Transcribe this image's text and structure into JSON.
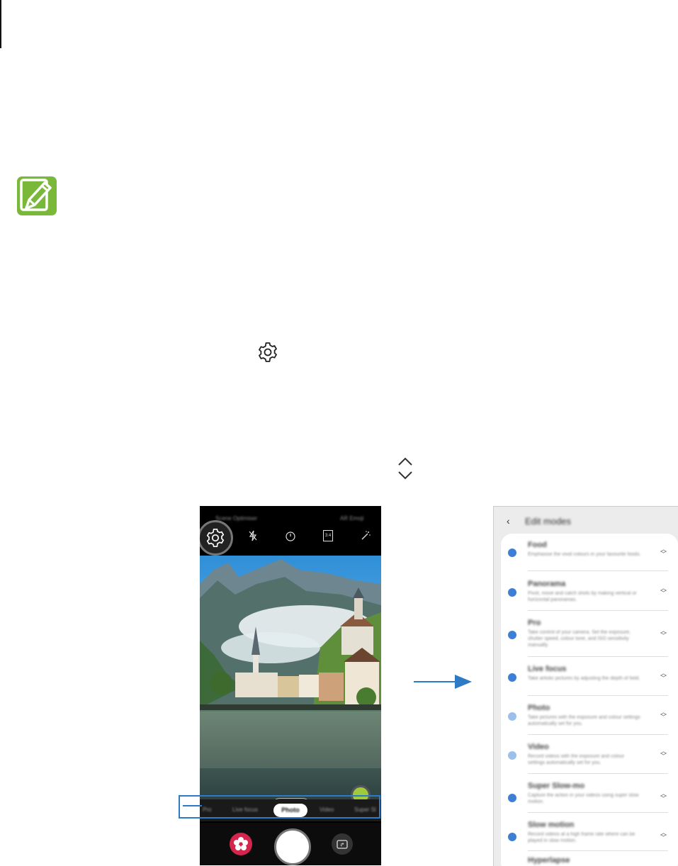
{
  "page": {
    "marker_color": "#111111",
    "note_icon": "note-pencil-icon",
    "note_icon_color": "#7ab83a",
    "inline_icons": [
      "gear-icon",
      "up-down-chevron-icon"
    ],
    "accent_color": "#2d7bc4"
  },
  "camera": {
    "top_left_text": "Scene Optimiser",
    "top_right_text": "AR Emoji",
    "toolbar_icons": [
      "settings-gear-icon",
      "flash-off-icon",
      "timer-off-icon",
      "ratio-icon",
      "filter-icon"
    ],
    "ratio_label": "3:4",
    "modes": [
      "Pro",
      "Live focus",
      "Photo",
      "Video",
      "Super Sl"
    ],
    "active_mode": "Photo",
    "lens_icons": [
      "wide-tree-icon",
      "tree-icon"
    ],
    "bottom_icons": [
      "gallery-flower-icon",
      "shutter-button",
      "switch-camera-icon"
    ]
  },
  "edit_modes": {
    "title": "Edit modes",
    "items": [
      {
        "name": "Food",
        "desc": "Emphasise the vivid colours in your favourite foods.",
        "enabled": true,
        "locked": false
      },
      {
        "name": "Panorama",
        "desc": "Pivot, move and catch shots by making vertical or horizontal panoramas.",
        "enabled": true,
        "locked": false
      },
      {
        "name": "Pro",
        "desc": "Take control of your camera. Set the exposure, shutter speed, colour tone, and ISO sensitivity manually.",
        "enabled": true,
        "locked": false
      },
      {
        "name": "Live focus",
        "desc": "Take artistic pictures by adjusting the depth of field.",
        "enabled": true,
        "locked": false
      },
      {
        "name": "Photo",
        "desc": "Take pictures with the exposure and colour settings automatically set for you.",
        "enabled": true,
        "locked": true
      },
      {
        "name": "Video",
        "desc": "Record videos with the exposure and colour settings automatically set for you.",
        "enabled": true,
        "locked": true
      },
      {
        "name": "Super Slow-mo",
        "desc": "Capture the action in your videos using super slow motion.",
        "enabled": true,
        "locked": false
      },
      {
        "name": "Slow motion",
        "desc": "Record videos at a high frame rate where can be played in slow motion.",
        "enabled": true,
        "locked": false
      },
      {
        "name": "Hyperlapse",
        "desc": "",
        "enabled": true,
        "locked": false
      }
    ]
  }
}
